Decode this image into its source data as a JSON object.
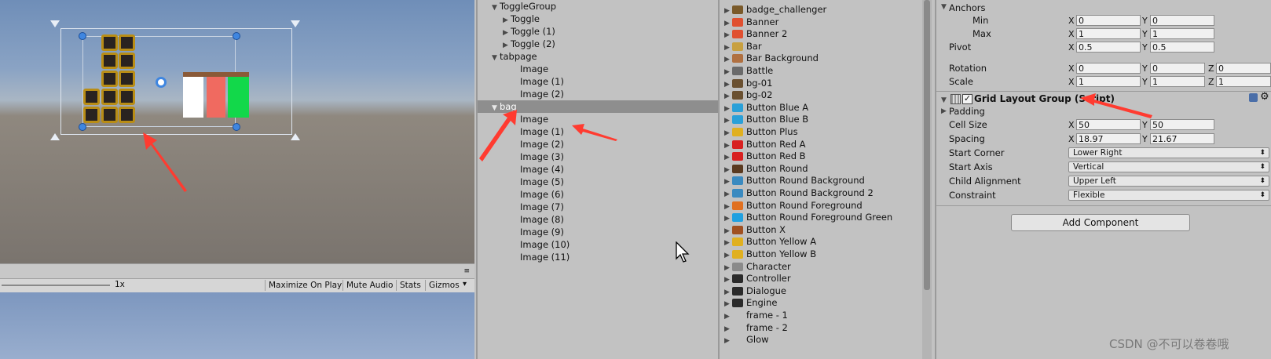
{
  "colors": {
    "accent_arrow": "#ff3b30",
    "selection": "#8e8e8e",
    "panel_bg": "#c2c2c2"
  },
  "game_toolbar": {
    "scale_label": "1x",
    "buttons": [
      "Maximize On Play",
      "Mute Audio",
      "Stats",
      "Gizmos"
    ],
    "gizmos_caret": "▾"
  },
  "hierarchy": {
    "items": [
      {
        "label": "ToggleGroup",
        "depth": 1,
        "arrow": "▼"
      },
      {
        "label": "Toggle",
        "depth": 2,
        "arrow": "▶"
      },
      {
        "label": "Toggle (1)",
        "depth": 2,
        "arrow": "▶"
      },
      {
        "label": "Toggle (2)",
        "depth": 2,
        "arrow": "▶"
      },
      {
        "label": "tabpage",
        "depth": 1,
        "arrow": "▼"
      },
      {
        "label": "Image",
        "depth": 3,
        "arrow": ""
      },
      {
        "label": "Image (1)",
        "depth": 3,
        "arrow": ""
      },
      {
        "label": "Image (2)",
        "depth": 3,
        "arrow": ""
      },
      {
        "label": "bag",
        "depth": 1,
        "arrow": "▼",
        "selected": true
      },
      {
        "label": "Image",
        "depth": 3,
        "arrow": ""
      },
      {
        "label": "Image (1)",
        "depth": 3,
        "arrow": ""
      },
      {
        "label": "Image (2)",
        "depth": 3,
        "arrow": ""
      },
      {
        "label": "Image (3)",
        "depth": 3,
        "arrow": ""
      },
      {
        "label": "Image (4)",
        "depth": 3,
        "arrow": ""
      },
      {
        "label": "Image (5)",
        "depth": 3,
        "arrow": ""
      },
      {
        "label": "Image (6)",
        "depth": 3,
        "arrow": ""
      },
      {
        "label": "Image (7)",
        "depth": 3,
        "arrow": ""
      },
      {
        "label": "Image (8)",
        "depth": 3,
        "arrow": ""
      },
      {
        "label": "Image (9)",
        "depth": 3,
        "arrow": ""
      },
      {
        "label": "Image (10)",
        "depth": 3,
        "arrow": ""
      },
      {
        "label": "Image (11)",
        "depth": 3,
        "arrow": ""
      }
    ]
  },
  "project": {
    "items": [
      {
        "label": "badge_challenger",
        "color": "#7a5a2a"
      },
      {
        "label": "Banner",
        "color": "#e05030"
      },
      {
        "label": "Banner 2",
        "color": "#e05030"
      },
      {
        "label": "Bar",
        "color": "#c8a040"
      },
      {
        "label": "Bar Background",
        "color": "#b07040"
      },
      {
        "label": "Battle",
        "color": "#6a6a6a"
      },
      {
        "label": "bg-01",
        "color": "#6a5030"
      },
      {
        "label": "bg-02",
        "color": "#6a5030"
      },
      {
        "label": "Button Blue A",
        "color": "#2aa0d8"
      },
      {
        "label": "Button Blue B",
        "color": "#2aa0d8"
      },
      {
        "label": "Button Plus",
        "color": "#e0b020"
      },
      {
        "label": "Button Red A",
        "color": "#d82020"
      },
      {
        "label": "Button Red B",
        "color": "#d82020"
      },
      {
        "label": "Button Round",
        "color": "#5a3a20"
      },
      {
        "label": "Button Round Background",
        "color": "#3a8ac0"
      },
      {
        "label": "Button Round Background 2",
        "color": "#3a8ac0"
      },
      {
        "label": "Button Round Foreground",
        "color": "#e07020"
      },
      {
        "label": "Button Round Foreground Green",
        "color": "#20a0e0"
      },
      {
        "label": "Button X",
        "color": "#a05020"
      },
      {
        "label": "Button Yellow A",
        "color": "#e0b020"
      },
      {
        "label": "Button Yellow B",
        "color": "#e0b020"
      },
      {
        "label": "Character",
        "color": "#8a8a8a"
      },
      {
        "label": "Controller",
        "color": "#2a2a2a"
      },
      {
        "label": "Dialogue",
        "color": "#2a2a2a"
      },
      {
        "label": "Engine",
        "color": "#2a2a2a"
      },
      {
        "label": "frame - 1",
        "color": ""
      },
      {
        "label": "frame - 2",
        "color": ""
      },
      {
        "label": "Glow",
        "color": ""
      }
    ]
  },
  "inspector": {
    "anchors_label": "Anchors",
    "min_label": "Min",
    "max_label": "Max",
    "pivot_label": "Pivot",
    "rotation_label": "Rotation",
    "scale_label": "Scale",
    "anchors_min": {
      "x": "0",
      "y": "0"
    },
    "anchors_max": {
      "x": "1",
      "y": "1"
    },
    "pivot": {
      "x": "0.5",
      "y": "0.5"
    },
    "rotation": {
      "x": "0",
      "y": "0",
      "z": "0"
    },
    "scale": {
      "x": "1",
      "y": "1",
      "z": "1"
    },
    "component_title": "Grid Layout Group (Script)",
    "padding_label": "Padding",
    "cell_size_label": "Cell Size",
    "cell_size": {
      "x": "50",
      "y": "50"
    },
    "spacing_label": "Spacing",
    "spacing": {
      "x": "18.97",
      "y": "21.67"
    },
    "start_corner_label": "Start Corner",
    "start_corner": "Lower Right",
    "start_axis_label": "Start Axis",
    "start_axis": "Vertical",
    "child_alignment_label": "Child Alignment",
    "child_alignment": "Upper Left",
    "constraint_label": "Constraint",
    "constraint": "Flexible",
    "add_component": "Add Component",
    "axis_x": "X",
    "axis_y": "Y",
    "axis_z": "Z"
  },
  "watermark": "CSDN @不可以卷卷哦"
}
